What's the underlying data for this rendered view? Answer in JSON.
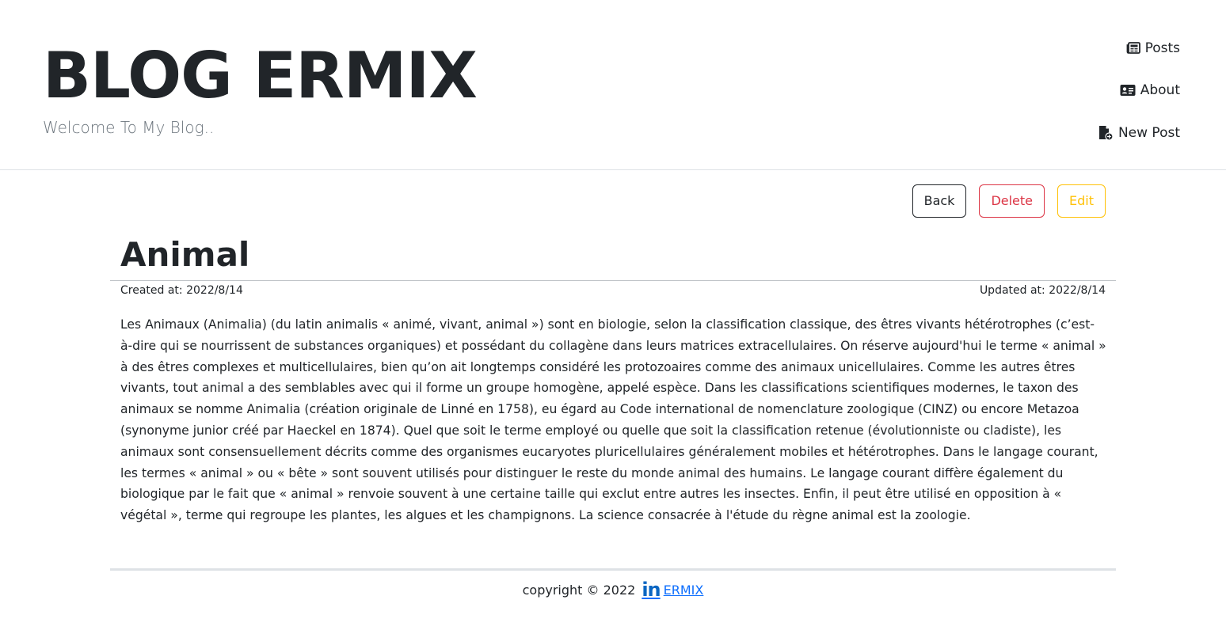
{
  "header": {
    "title": "BLOG ERMIX",
    "tagline": "Welcome To My Blog.."
  },
  "nav": {
    "items": [
      {
        "label": "Posts",
        "icon": "newspaper-icon"
      },
      {
        "label": "About",
        "icon": "id-card-icon"
      },
      {
        "label": "New Post",
        "icon": "file-plus-icon"
      }
    ]
  },
  "actions": {
    "back_label": "Back",
    "delete_label": "Delete",
    "edit_label": "Edit"
  },
  "post": {
    "title": "Animal",
    "created": "Created at: 2022/8/14",
    "updated": "Updated at: 2022/8/14",
    "body": "Les Animaux (Animalia) (du latin animalis « animé, vivant, animal ») sont en biologie, selon la classification classique, des êtres vivants hétérotrophes (c’est-à-dire qui se nourrissent de substances organiques) et possédant du collagène dans leurs matrices extracellulaires. On réserve aujourd'hui le terme « animal » à des êtres complexes et multicellulaires, bien qu’on ait longtemps considéré les protozoaires comme des animaux unicellulaires. Comme les autres êtres vivants, tout animal a des semblables avec qui il forme un groupe homogène, appelé espèce. Dans les classifications scientifiques modernes, le taxon des animaux se nomme Animalia (création originale de Linné en 1758), eu égard au Code international de nomenclature zoologique (CINZ) ou encore Metazoa (synonyme junior créé par Haeckel en 1874). Quel que soit le terme employé ou quelle que soit la classification retenue (évolutionniste ou cladiste), les animaux sont consensuellement décrits comme des organismes eucaryotes pluricellulaires généralement mobiles et hétérotrophes. Dans le langage courant, les termes « animal » ou « bête » sont souvent utilisés pour distinguer le reste du monde animal des humains. Le langage courant diffère également du biologique par le fait que « animal » renvoie souvent à une certaine taille qui exclut entre autres les insectes. Enfin, il peut être utilisé en opposition à « végétal », terme qui regroupe les plantes, les algues et les champignons. La science consacrée à l'étude du règne animal est la zoologie."
  },
  "footer": {
    "copyright": "copyright © 2022",
    "linkedin_mark": "in",
    "link_label": "ERMIX",
    "link_icon": "linkedin-icon"
  },
  "colors": {
    "danger": "#dc3545",
    "warning": "#ffc107",
    "link": "#0d6efd",
    "linkedin": "#0a66c2"
  }
}
